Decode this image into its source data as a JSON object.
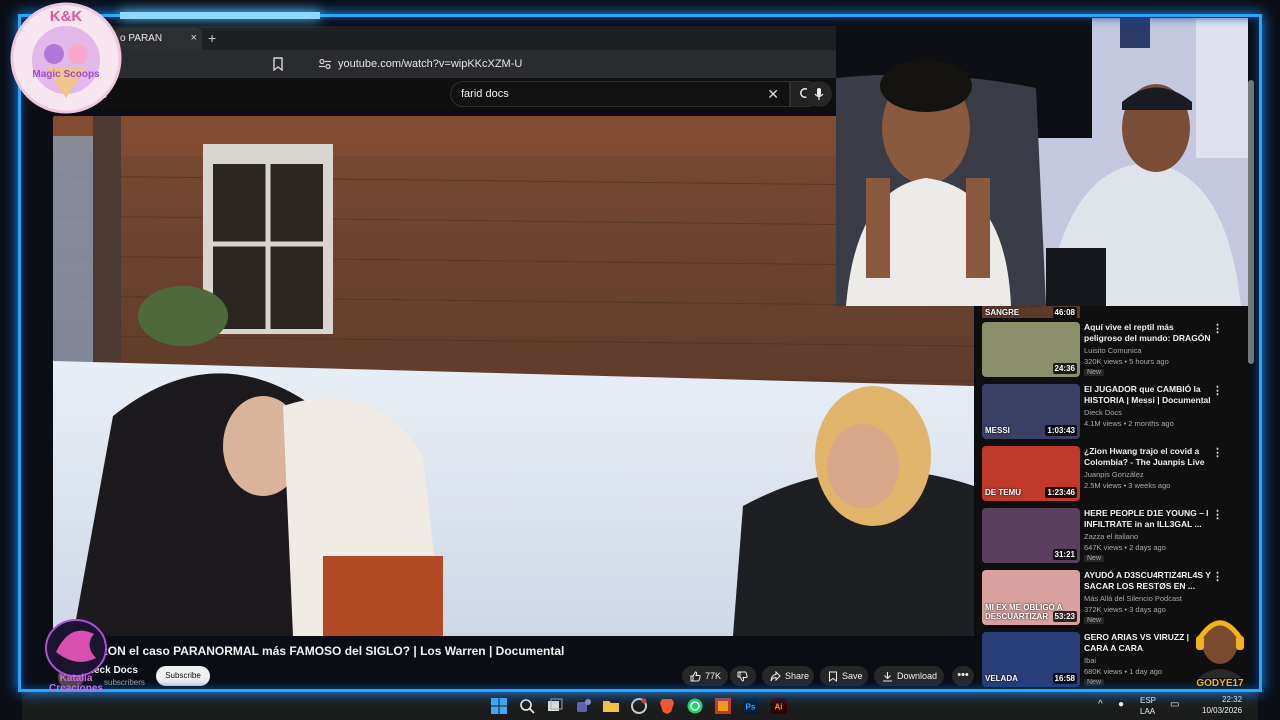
{
  "browser": {
    "tab_title": "o PARAN",
    "tab_close": "×",
    "new_tab": "+",
    "url": "youtube.com/watch?v=wipKKcXZM-U"
  },
  "youtube": {
    "logo_fragment": "e",
    "search_value": "farid docs",
    "clear_glyph": "✕"
  },
  "video": {
    "title": "TARON el caso PARANORMAL más FAMOSO del SIGLO? | Los Warren | Documental",
    "channel": "Dieck Docs",
    "subscribers": "subscribers",
    "subscribe_label": "Subscribe",
    "likes": "77K",
    "share_label": "Share",
    "save_label": "Save",
    "download_label": "Download",
    "more_glyph": "•••"
  },
  "sidebar": {
    "top_partial_text": "DIAMANTE DE SANGRE",
    "top_partial_duration": "46:08",
    "items": [
      {
        "title": "Aquí vive el reptil más peligroso del mundo: DRAGÓN DE ...",
        "channel": "Luisito Comunica",
        "meta": "320K views • 5 hours ago",
        "badge": "New",
        "duration": "24:36",
        "thumb_text": "",
        "thumb_color": "#8a8f6a"
      },
      {
        "title": "El JUGADOR que CAMBIÓ la HISTORIA | Messi | Documental",
        "channel": "Dieck Docs",
        "meta": "4.1M views • 2 months ago",
        "badge": "",
        "duration": "1:03:43",
        "thumb_text": "MESSI",
        "thumb_color": "#3a3f66"
      },
      {
        "title": "¿Zion Hwang trajo el covid a Colombia? - The Juanpis Live ...",
        "channel": "Juanpis González",
        "meta": "2.5M views • 3 weeks ago",
        "badge": "",
        "duration": "1:23:46",
        "thumb_text": "DE TEMU",
        "thumb_color": "#c0392b"
      },
      {
        "title": "HERE PEOPLE D1E YOUNG – I INFILTRATE in an ILL3GAL ...",
        "channel": "Zazza el italiano",
        "meta": "647K views • 2 days ago",
        "badge": "New",
        "duration": "31:21",
        "thumb_text": "",
        "thumb_color": "#5a3f5e"
      },
      {
        "title": "AYUDÓ A D3SCU4RTIZ4RL4S Y SACAR LOS RESTØS EN ...",
        "channel": "Más Allá del Silencio Podcast",
        "meta": "372K views • 3 days ago",
        "badge": "New",
        "duration": "53:23",
        "thumb_text": "MI EX ME OBLIGÓ A DESCUARTIZAR",
        "thumb_color": "#d9a0a0"
      },
      {
        "title": "GERO ARIAS VS VIRUZZ | CARA A CARA",
        "channel": "Ibai",
        "meta": "680K views • 1 day ago",
        "badge": "New",
        "duration": "16:58",
        "thumb_text": "VELADA",
        "thumb_color": "#2a3f7a"
      }
    ]
  },
  "taskbar": {
    "lang_top": "ESP",
    "lang_bottom": "LAA",
    "time": "22:32",
    "date": "10/03/2026"
  },
  "overlays": {
    "logo_top": "K&K",
    "logo_top_sub": "Magic Scoops",
    "logo_bottom_left": "Katalia Creaciones",
    "logo_bottom_right": "GODYE17"
  },
  "colors": {
    "frame": "#23a8ff",
    "yt_bg": "#0f0f0f",
    "pill_bg": "#272727"
  },
  "icons": [
    "bookmark-icon",
    "site-info-icon",
    "search-icon",
    "mic-icon",
    "thumbs-up-icon",
    "thumbs-down-icon",
    "share-icon",
    "save-icon",
    "download-icon",
    "windows-icon"
  ]
}
